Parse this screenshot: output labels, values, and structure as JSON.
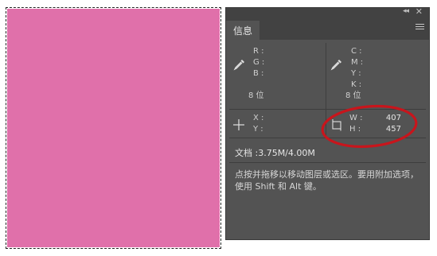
{
  "canvas": {
    "fill_color": "#e070aa",
    "selection": "marquee"
  },
  "panel": {
    "header": {
      "collapse_glyph": "◂◂",
      "close_glyph": "✕"
    },
    "tab_label": "信息",
    "menu_icon": "hamburger-icon",
    "rgb": {
      "r_label": "R :",
      "g_label": "G :",
      "b_label": "B :",
      "bit_depth": "8 位"
    },
    "cmyk": {
      "c_label": "C :",
      "m_label": "M :",
      "y_label": "Y :",
      "k_label": "K :",
      "bit_depth": "8 位"
    },
    "position": {
      "x_label": "X :",
      "y_label": "Y :"
    },
    "size": {
      "w_label": "W :",
      "h_label": "H :",
      "w_value": "407",
      "h_value": "457"
    },
    "document": "文档 :3.75M/4.00M",
    "hint": "点按并拖移以移动图层或选区。要用附加选项，使用 Shift 和 Alt 键。"
  },
  "annotation": {
    "color": "#c8151c"
  }
}
